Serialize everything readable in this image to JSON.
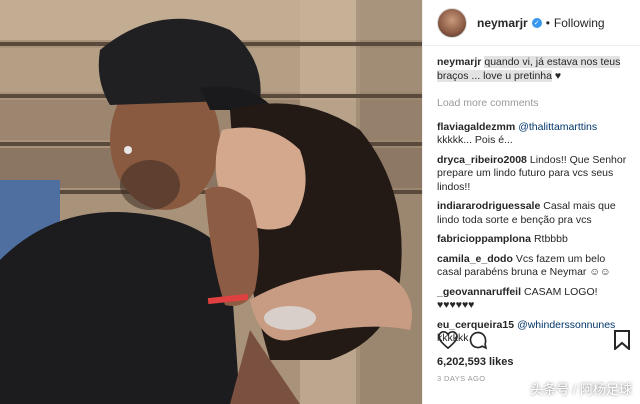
{
  "post": {
    "photo_icon": "kissing-couple-photo",
    "header": {
      "username": "neymarjr",
      "verified_icon": "verified-badge-icon",
      "separator": "•",
      "follow_status": "Following"
    },
    "caption": {
      "username": "neymarjr",
      "text": "quando vi, já estava nos teus braços ... love u pretinha",
      "emoji": "♥"
    },
    "load_more": "Load more comments",
    "comments": [
      {
        "username": "flaviagaldezmm",
        "mention": "@thalittamarttins",
        "text": " kkkkk... Pois é..."
      },
      {
        "username": "dryca_ribeiro2008",
        "mention": "",
        "text": "Lindos!! Que Senhor prepare um lindo futuro para vcs seus lindos!!"
      },
      {
        "username": "indiararodriguessale",
        "mention": "",
        "text": "Casal mais que lindo toda sorte e benção pra vcs"
      },
      {
        "username": "fabricioppamplona",
        "mention": "",
        "text": "Rtbbbb"
      },
      {
        "username": "camila_e_dodo",
        "mention": "",
        "text": "Vcs fazem um belo casal parabéns bruna e Neymar ☺☺"
      },
      {
        "username": "_geovannaruffeil",
        "mention": "",
        "text": "CASAM LOGO! ♥♥♥♥♥♥"
      },
      {
        "username": "eu_cerqueira15",
        "mention": "@whinderssonnunes",
        "text": " kkkkkk"
      }
    ],
    "actions": {
      "like_icon": "heart-icon",
      "comment_icon": "comment-icon",
      "save_icon": "bookmark-icon"
    },
    "likes": "6,202,593 likes",
    "time_ago": "3 DAYS AGO"
  },
  "watermark": "头条号 / 阿杨足球",
  "colors": {
    "link": "#003569",
    "verified": "#3897f0",
    "muted": "#999999",
    "caption_highlight": "#e3e3e3"
  }
}
